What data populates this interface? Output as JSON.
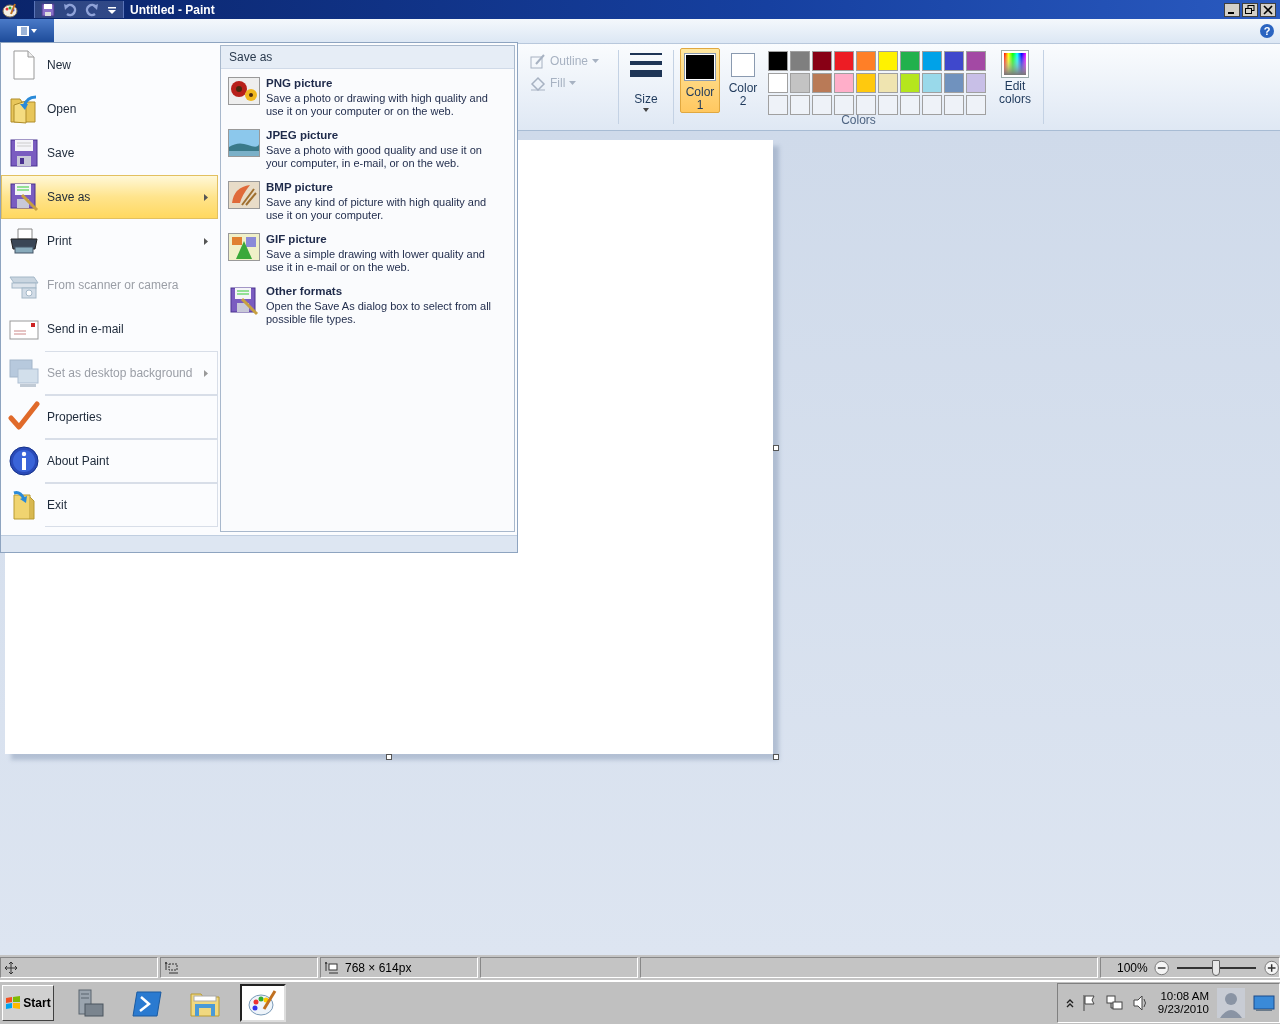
{
  "window": {
    "title": "Untitled - Paint"
  },
  "help": {
    "glyph": "?"
  },
  "ribbon": {
    "tools": [
      {
        "label": "Outline",
        "disabled": true
      },
      {
        "label": "Fill",
        "disabled": true
      }
    ],
    "size": {
      "label": "Size"
    },
    "color_slots": [
      {
        "label": "Color 1",
        "color": "#000000",
        "selected": true
      },
      {
        "label": "Color 2",
        "color": "#ffffff",
        "selected": false
      }
    ],
    "palette": [
      {
        "kind": "color",
        "color": "#000000"
      },
      {
        "kind": "color",
        "color": "#7f7f7f"
      },
      {
        "kind": "color",
        "color": "#880015"
      },
      {
        "kind": "color",
        "color": "#ed1c24"
      },
      {
        "kind": "color",
        "color": "#ff7f27"
      },
      {
        "kind": "color",
        "color": "#fff200"
      },
      {
        "kind": "color",
        "color": "#22b14c"
      },
      {
        "kind": "color",
        "color": "#00a2e8"
      },
      {
        "kind": "color",
        "color": "#3f48cc"
      },
      {
        "kind": "color",
        "color": "#a349a4"
      },
      {
        "kind": "color",
        "color": "#ffffff"
      },
      {
        "kind": "color",
        "color": "#c3c3c3"
      },
      {
        "kind": "color",
        "color": "#b97a57"
      },
      {
        "kind": "color",
        "color": "#ffaec9"
      },
      {
        "kind": "color",
        "color": "#ffc90e"
      },
      {
        "kind": "color",
        "color": "#efe4b0"
      },
      {
        "kind": "color",
        "color": "#b5e61d"
      },
      {
        "kind": "color",
        "color": "#99d9ea"
      },
      {
        "kind": "color",
        "color": "#7092be"
      },
      {
        "kind": "color",
        "color": "#c8bfe7"
      },
      {
        "kind": "empty"
      },
      {
        "kind": "empty"
      },
      {
        "kind": "empty"
      },
      {
        "kind": "empty"
      },
      {
        "kind": "empty"
      },
      {
        "kind": "empty"
      },
      {
        "kind": "empty"
      },
      {
        "kind": "empty"
      },
      {
        "kind": "empty"
      },
      {
        "kind": "empty"
      }
    ],
    "edit_colors": {
      "label": "Edit colors"
    },
    "group_label": "Colors"
  },
  "app_menu": {
    "items": [
      {
        "label": "New",
        "disabled": false,
        "selected": false,
        "submenu": false,
        "separator_before": false
      },
      {
        "label": "Open",
        "disabled": false,
        "selected": false,
        "submenu": false,
        "separator_before": false
      },
      {
        "label": "Save",
        "disabled": false,
        "selected": false,
        "submenu": false,
        "separator_before": false
      },
      {
        "label": "Save as",
        "disabled": false,
        "selected": true,
        "submenu": true,
        "separator_before": false
      },
      {
        "label": "Print",
        "disabled": false,
        "selected": false,
        "submenu": true,
        "separator_before": false
      },
      {
        "label": "From scanner or camera",
        "disabled": true,
        "selected": false,
        "submenu": false,
        "separator_before": false
      },
      {
        "label": "Send in e-mail",
        "disabled": false,
        "selected": false,
        "submenu": false,
        "separator_before": false
      },
      {
        "label": "Set as desktop background",
        "disabled": true,
        "selected": false,
        "submenu": true,
        "separator_before": true
      },
      {
        "label": "Properties",
        "disabled": false,
        "selected": false,
        "submenu": false,
        "separator_before": true
      },
      {
        "label": "About Paint",
        "disabled": false,
        "selected": false,
        "submenu": false,
        "separator_before": true
      },
      {
        "label": "Exit",
        "disabled": false,
        "selected": false,
        "submenu": false,
        "separator_before": true
      }
    ],
    "submenu": {
      "title": "Save as",
      "entries": [
        {
          "title": "PNG picture",
          "description": "Save a photo or drawing with high quality and use it on your computer or on the web."
        },
        {
          "title": "JPEG picture",
          "description": "Save a photo with good quality and use it on your computer, in e-mail, or on the web."
        },
        {
          "title": "BMP picture",
          "description": "Save any kind of picture with high quality and use it on your computer."
        },
        {
          "title": "GIF picture",
          "description": "Save a simple drawing with lower quality and use it in e-mail or on the web."
        },
        {
          "title": "Other formats",
          "description": "Open the Save As dialog box to select from all possible file types."
        }
      ]
    }
  },
  "status_bar": {
    "panes": [
      {
        "kind": "position"
      },
      {
        "kind": "selection"
      },
      {
        "kind": "size",
        "text": "768 × 614px"
      },
      {
        "kind": "empty"
      },
      {
        "kind": "empty"
      }
    ],
    "zoom": {
      "text": "100%",
      "level": 0.5
    }
  },
  "taskbar": {
    "start": "Start",
    "apps": [
      {
        "kind": "server",
        "selected": false
      },
      {
        "kind": "shell",
        "selected": false
      },
      {
        "kind": "explorer",
        "selected": false
      },
      {
        "kind": "paint",
        "selected": true
      }
    ],
    "tray": {
      "time": "10:08 AM",
      "date": "9/23/2010"
    }
  }
}
